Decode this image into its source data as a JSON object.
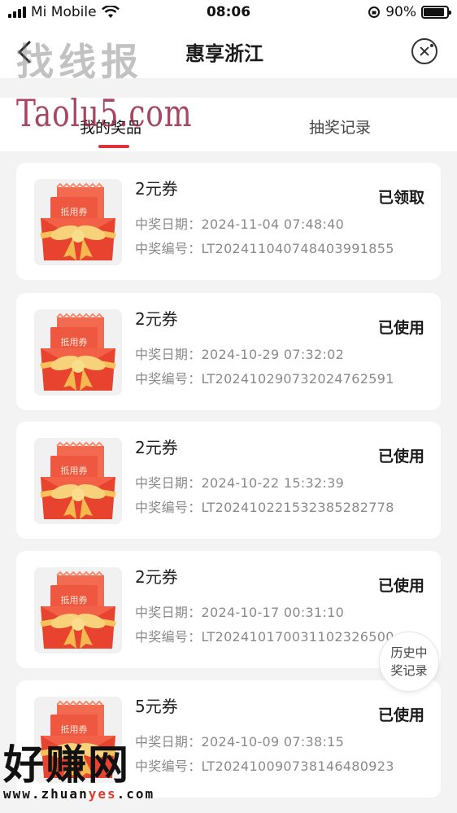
{
  "status_bar": {
    "carrier": "Mi Mobile",
    "time": "08:06",
    "battery": "90%",
    "battery_level": 0.9
  },
  "nav": {
    "title": "惠享浙江"
  },
  "watermarks": {
    "top": "找线报",
    "url": "Taolu5.com",
    "bottom_big": "好赚网",
    "bottom_small_a": "www.zhuan",
    "bottom_small_b": "yes",
    "bottom_small_c": ".com"
  },
  "tabs": [
    {
      "label": "我的奖品",
      "active": true
    },
    {
      "label": "抽奖记录",
      "active": false
    }
  ],
  "thumb_label": "抵用券",
  "labels": {
    "date": "中奖日期：",
    "code": "中奖编号："
  },
  "prizes": [
    {
      "title": "2元券",
      "status": "已领取",
      "date": "2024-11-04 07:48:40",
      "code": "LT20241104074840399185 5"
    },
    {
      "title": "2元券",
      "status": "已使用",
      "date": "2024-10-29 07:32:02",
      "code": "LT20241029073202476259 1"
    },
    {
      "title": "2元券",
      "status": "已使用",
      "date": "2024-10-22 15:32:39",
      "code": "LT20241022153238528277 8"
    },
    {
      "title": "2元券",
      "status": "已使用",
      "date": "2024-10-17 00:31:10",
      "code": "LT20241017003110232650 0"
    },
    {
      "title": "5元券",
      "status": "已使用",
      "date": "2024-10-09 07:38:15",
      "code": "LT20241009073814648092 3"
    }
  ],
  "history_button": {
    "line1": "历史中",
    "line2": "奖记录"
  }
}
